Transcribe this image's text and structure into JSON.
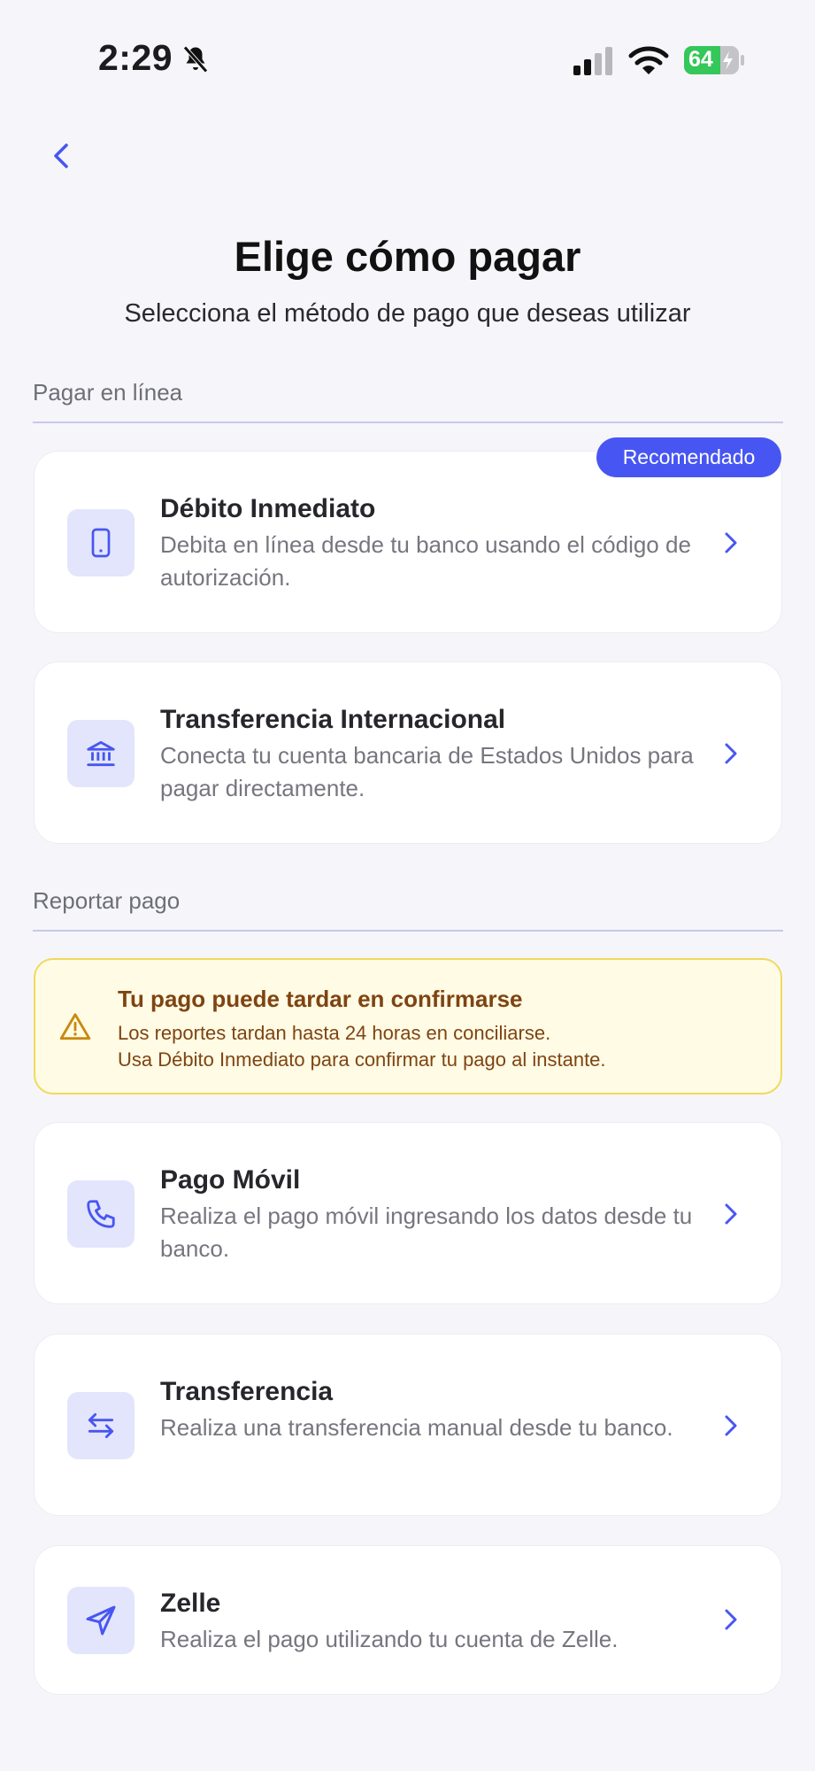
{
  "status_bar": {
    "time": "2:29",
    "battery": "64"
  },
  "header": {
    "title": "Elige cómo pagar",
    "subtitle": "Selecciona el método de pago que deseas utilizar"
  },
  "sections": {
    "online": "Pagar en línea",
    "report": "Reportar pago"
  },
  "badge": "Recomendado",
  "methods": [
    {
      "icon": "smartphone-icon",
      "title": "Débito Inmediato",
      "desc": "Debita en línea desde tu banco usando el código de autorización."
    },
    {
      "icon": "bank-icon",
      "title": "Transferencia Internacional",
      "desc": "Conecta tu cuenta bancaria de Estados Unidos para pagar directamente."
    },
    {
      "icon": "phone-icon",
      "title": "Pago Móvil",
      "desc": "Realiza el pago móvil ingresando los datos desde tu banco."
    },
    {
      "icon": "arrows-swap-icon",
      "title": "Transferencia",
      "desc": "Realiza una transferencia manual desde tu banco."
    },
    {
      "icon": "send-icon",
      "title": "Zelle",
      "desc": "Realiza el pago utilizando tu cuenta de Zelle."
    }
  ],
  "warning": {
    "title": "Tu pago puede tardar en confirmarse",
    "line1": "Los reportes tardan hasta 24 horas en conciliarse.",
    "line2": "Usa Débito Inmediato para confirmar tu pago al instante."
  },
  "colors": {
    "accent": "#4756f2",
    "icon_bg": "#e3e5fc",
    "warning_bg": "#fffbe5",
    "warning_text": "#7f4412",
    "background": "#f6f6fa"
  }
}
